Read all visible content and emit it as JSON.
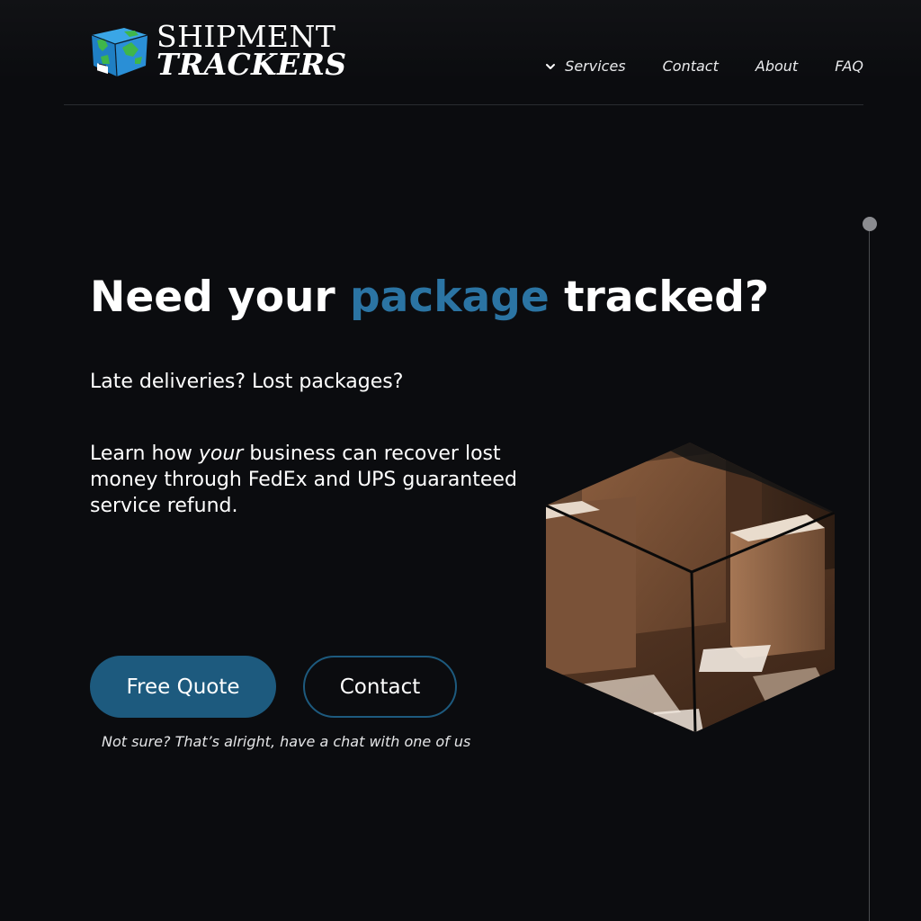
{
  "header": {
    "logo": {
      "line1": "SHIPMENT",
      "line2": "TRACKERS",
      "icon": "box-globe-icon"
    },
    "nav": [
      {
        "label": "Services",
        "icon": "chevron-down-icon"
      },
      {
        "label": "Contact"
      },
      {
        "label": "About"
      },
      {
        "label": "FAQ"
      }
    ]
  },
  "hero": {
    "title_before": "Need your ",
    "title_accent": "package",
    "title_after": " tracked?",
    "subtitle": "Late deliveries? Lost packages?",
    "body_before": "Learn how ",
    "body_emphasis": "your",
    "body_after": " business can recover lost money through FedEx and UPS guaranteed service refund.",
    "primary_button": "Free Quote",
    "secondary_button": "Contact",
    "helper_text": "Not sure? That’s alright, have a chat with one of us",
    "image": "cardboard-boxes-hexagon-image"
  },
  "colors": {
    "background": "#0b0c0f",
    "accent": "#2b74a3",
    "button": "#1d5a7e",
    "text": "#ffffff"
  }
}
